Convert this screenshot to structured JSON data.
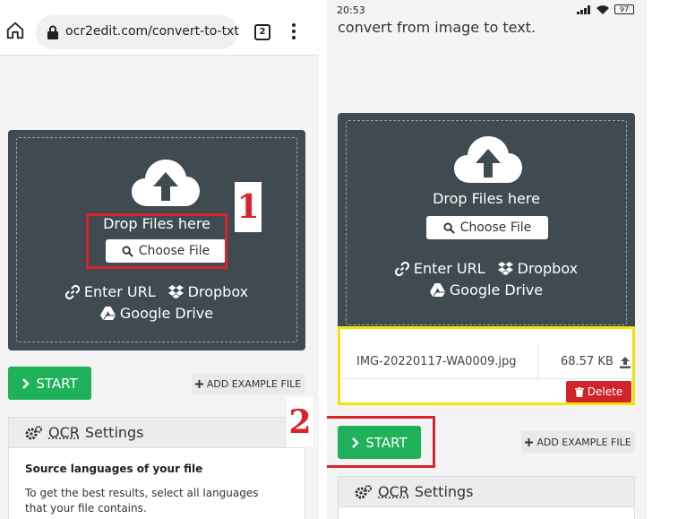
{
  "left_phone": {
    "browser": {
      "url": "ocr2edit.com/convert-to-txt",
      "tab_count": "2"
    },
    "upload": {
      "drop_text": "Drop Files here",
      "choose_label": "Choose File",
      "enter_url_label": "Enter URL",
      "dropbox_label": "Dropbox",
      "google_drive_label": "Google Drive"
    },
    "start_label": "START",
    "add_example_label": "ADD EXAMPLE FILE",
    "ocr": {
      "title_abbr": "OCR",
      "title_rest": "Settings",
      "source_title": "Source languages of your file",
      "source_desc": "To get the best results, select all languages that your file contains."
    },
    "step_number": "1"
  },
  "right_phone": {
    "status": {
      "time": "20:53",
      "battery": "97"
    },
    "intro_text": "convert from image to text.",
    "upload": {
      "drop_text": "Drop Files here",
      "choose_label": "Choose File",
      "enter_url_label": "Enter URL",
      "dropbox_label": "Dropbox",
      "google_drive_label": "Google Drive"
    },
    "file": {
      "name": "IMG-20220117-WA0009.jpg",
      "size": "68.57 KB",
      "delete_label": "Delete"
    },
    "start_label": "START",
    "add_example_label": "ADD EXAMPLE FILE",
    "ocr": {
      "title_abbr": "OCR",
      "title_rest": "Settings"
    },
    "step_number": "2"
  },
  "colors": {
    "panel": "#3f4b50",
    "start_green": "#1fb25a",
    "delete_red": "#d0232a",
    "marker_red": "#d9232d",
    "marker_yellow": "#f2e300"
  },
  "icons": [
    "home-icon",
    "lock-icon",
    "tabs-icon",
    "menu-icon",
    "cloud-upload-icon",
    "search-icon",
    "link-icon",
    "dropbox-icon",
    "google-drive-icon",
    "chevron-right-icon",
    "plus-icon",
    "gears-icon",
    "upload-icon",
    "trash-icon"
  ]
}
